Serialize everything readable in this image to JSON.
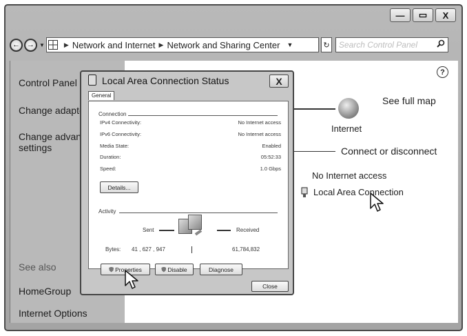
{
  "window": {
    "controls": [
      "—",
      "▭",
      "X"
    ]
  },
  "address_bar": {
    "breadcrumbs": [
      "Network and Internet",
      "Network and Sharing Center"
    ],
    "search_placeholder": "Search Control Panel"
  },
  "sidebar": {
    "items": [
      "Control Panel",
      "Change adapter",
      "Change advanced",
      "settings"
    ],
    "see_also_heading": "See also",
    "see_also_items": [
      "HomeGroup",
      "Internet Options"
    ]
  },
  "main": {
    "see_full_map": "See full map",
    "internet_label": "Internet",
    "connect_disconnect": "Connect or disconnect",
    "access_type": "No Internet  access",
    "connection_name": "Local Area Connection"
  },
  "dialog": {
    "title": "Local Area Connection Status",
    "close_glyph": "X",
    "tab_general": "General",
    "connection_group": "Connection",
    "rows": [
      {
        "label": "IPv4 Connectivity:",
        "value": "No Internet access"
      },
      {
        "label": "IPv6 Connectivity:",
        "value": "No Internet access"
      },
      {
        "label": "Media State:",
        "value": "Enabled"
      },
      {
        "label": "Duration:",
        "value": "05:52:33"
      },
      {
        "label": "Speed:",
        "value": "1.0 Gbps"
      }
    ],
    "details_button": "Details...",
    "activity_group": "Activity",
    "sent_label": "Sent",
    "received_label": "Received",
    "bytes_label": "Bytes:",
    "bytes_sent": "41 , 627 , 947",
    "bytes_received": "61,784,832",
    "properties_button": "Properties",
    "disable_button": "Disable",
    "diagnose_button": "Diagnose",
    "close_button": "Close"
  }
}
